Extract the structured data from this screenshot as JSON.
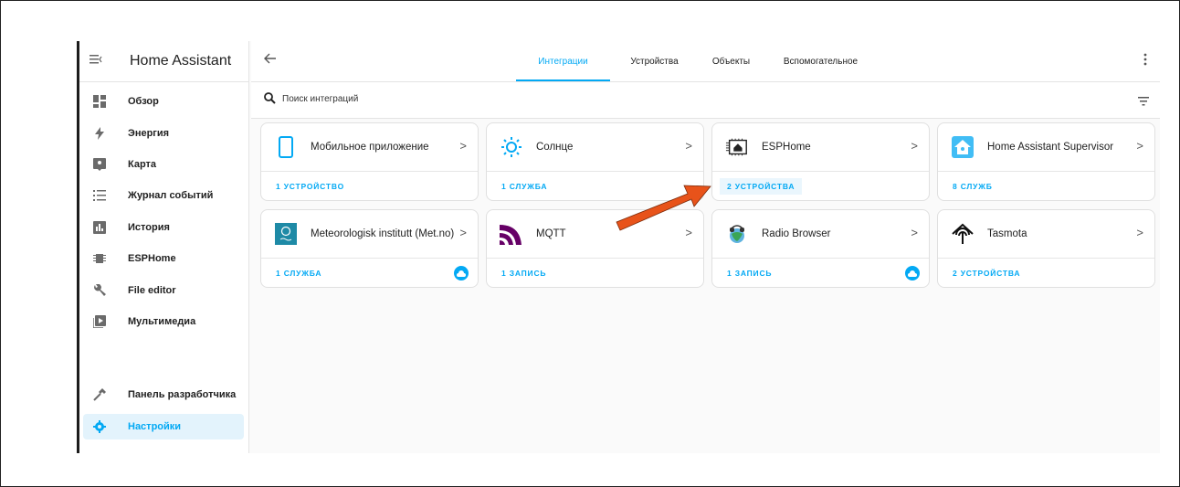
{
  "app_title": "Home Assistant",
  "sidebar": {
    "items": [
      {
        "label": "Обзор",
        "icon": "dashboard-icon"
      },
      {
        "label": "Энергия",
        "icon": "lightning-icon"
      },
      {
        "label": "Карта",
        "icon": "map-icon"
      },
      {
        "label": "Журнал событий",
        "icon": "logbook-icon"
      },
      {
        "label": "История",
        "icon": "history-chart-icon"
      },
      {
        "label": "ESPHome",
        "icon": "esphome-chip-icon"
      },
      {
        "label": "File editor",
        "icon": "wrench-icon"
      },
      {
        "label": "Мультимедиа",
        "icon": "media-play-icon"
      }
    ],
    "bottom": [
      {
        "label": "Панель разработчика",
        "icon": "hammer-icon"
      },
      {
        "label": "Настройки",
        "icon": "gear-icon"
      }
    ]
  },
  "tabs": [
    "Интеграции",
    "Устройства",
    "Объекты",
    "Вспомогательное"
  ],
  "active_tab": "Интеграции",
  "search": {
    "placeholder": "Поиск интеграций"
  },
  "integrations": [
    {
      "name": "Мобильное приложение",
      "link": "1 УСТРОЙСТВО",
      "icon": "mobile-phone-icon",
      "cloud": false
    },
    {
      "name": "Солнце",
      "link": "1 СЛУЖБА",
      "icon": "sun-icon",
      "cloud": false
    },
    {
      "name": "ESPHome",
      "link": "2 УСТРОЙСТВА",
      "icon": "esphome-logo-icon",
      "cloud": false,
      "highlighted": true
    },
    {
      "name": "Home Assistant Supervisor",
      "link": "8 СЛУЖБ",
      "icon": "home-assistant-logo-icon",
      "cloud": false
    },
    {
      "name": "Meteorologisk institutt (Met.no)",
      "link": "1 СЛУЖБА",
      "icon": "met-no-logo-icon",
      "cloud": true
    },
    {
      "name": "MQTT",
      "link": "1 ЗАПИСЬ",
      "icon": "mqtt-logo-icon",
      "cloud": false
    },
    {
      "name": "Radio Browser",
      "link": "1 ЗАПИСЬ",
      "icon": "radio-browser-logo-icon",
      "cloud": true
    },
    {
      "name": "Tasmota",
      "link": "2 УСТРОЙСТВА",
      "icon": "tasmota-logo-icon",
      "cloud": false
    }
  ],
  "colors": {
    "accent": "#03a9f4",
    "annotation_arrow": "#e8531a"
  }
}
